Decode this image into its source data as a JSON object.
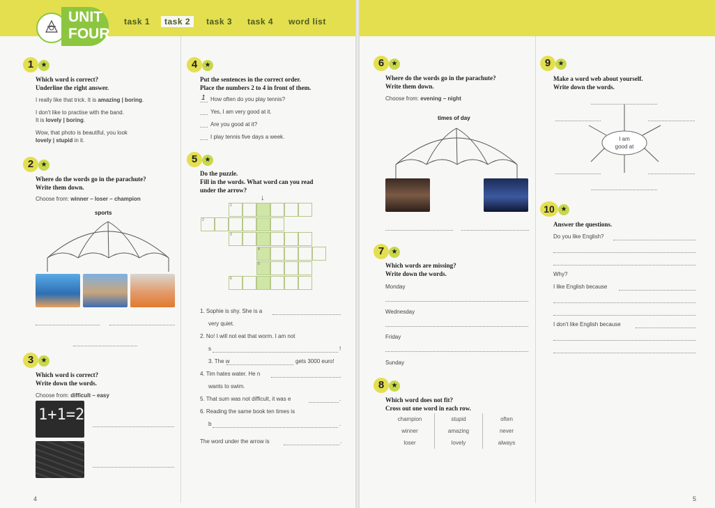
{
  "unit": {
    "line1": "UNIT",
    "line2": "FOUR"
  },
  "tabs": [
    "task 1",
    "task 2",
    "task 3",
    "task 4",
    "word list"
  ],
  "active_tab": "task 2",
  "ex1": {
    "num": "1",
    "head1": "Which word is correct?",
    "head2": "Underline the right answer.",
    "s1a": "I really like that trick. It is ",
    "s1b": "amazing | boring",
    "s1c": ".",
    "s2": "I don't like to practise with the band.",
    "s2a": "It is ",
    "s2b": "lovely | boring",
    "s2c": ".",
    "s3": "Wow, that photo is beautiful, you look",
    "s3b": "lovely | stupid",
    "s3c": " in it."
  },
  "ex2": {
    "num": "2",
    "head1": "Where do the words go in the parachute?",
    "head2": "Write them down.",
    "choose": "Choose from: ",
    "choices": "winner – loser – champion",
    "label": "sports"
  },
  "ex3": {
    "num": "3",
    "head1": "Which word is correct?",
    "head2": "Write down the words.",
    "choose": "Choose from: ",
    "choices": "difficult – easy",
    "board": "1+1=2"
  },
  "ex4": {
    "num": "4",
    "head1": "Put the sentences in the correct order.",
    "head2": "Place the numbers 2 to 4 in front of them.",
    "first": "1",
    "items": [
      "How often do you play tennis?",
      "Yes, I am very good at it.",
      "Are you good at it?",
      "I play tennis five days a week."
    ]
  },
  "ex5": {
    "num": "5",
    "head1": "Do the puzzle.",
    "head2": "Fill in the words. What word can you read",
    "head3": "under the arrow?",
    "arrow": "↓",
    "clue_nums": [
      "1",
      "2",
      "3",
      "4",
      "5",
      "6"
    ],
    "clues": [
      "1. Sophie is shy. She is a",
      "very quiet.",
      "2. No! I will not eat that worm. I am not",
      "s",
      "!",
      "3. The w",
      "gets 3000 euro!",
      "4. Tim hates water. He n",
      "wants to swim.",
      "5. That sum was not difficult, it was e",
      ".",
      "6. Reading the same book ten times is",
      "b",
      "."
    ],
    "final": "The word under the arrow is",
    "final_end": "."
  },
  "ex6": {
    "num": "6",
    "head1": "Where do the words go in the parachute?",
    "head2": "Write them down.",
    "choose": "Choose from: ",
    "choices": "evening – night",
    "label": "times of day"
  },
  "ex7": {
    "num": "7",
    "head1": "Which words are missing?",
    "head2": "Write down the words.",
    "days": [
      "Monday",
      "Wednesday",
      "Friday",
      "Sunday"
    ]
  },
  "ex8": {
    "num": "8",
    "head1": "Which word does not fit?",
    "head2": "Cross out one word in each row.",
    "rows": [
      [
        "champion",
        "stupid",
        "often"
      ],
      [
        "winner",
        "amazing",
        "never"
      ],
      [
        "loser",
        "lovely",
        "always"
      ]
    ]
  },
  "ex9": {
    "num": "9",
    "head1": "Make a word web about yourself.",
    "head2": "Write down the words.",
    "center1": "I am",
    "center2": "good at"
  },
  "ex10": {
    "num": "10",
    "head1": "Answer the questions.",
    "q1": "Do you like English?",
    "q2": "Why?",
    "q3": "I like English because",
    "q4": "I don't like English because"
  },
  "page_left": "4",
  "page_right": "5",
  "colors": {
    "accent": "#e3df4f",
    "star": "#c9d84a",
    "logo": "#8cc63f"
  }
}
